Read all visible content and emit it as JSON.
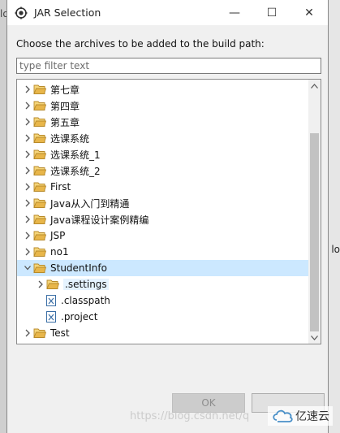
{
  "window": {
    "title": "JAR Selection",
    "minimize_glyph": "—",
    "maximize_glyph": "☐",
    "close_glyph": "✕"
  },
  "instruction": "Choose the archives to be added to the build path:",
  "filter": {
    "placeholder": "type filter text",
    "value": ""
  },
  "tree": {
    "items": [
      {
        "label": "第七章",
        "type": "folder",
        "expanded": false,
        "depth": 0
      },
      {
        "label": "第四章",
        "type": "folder",
        "expanded": false,
        "depth": 0
      },
      {
        "label": "第五章",
        "type": "folder",
        "expanded": false,
        "depth": 0
      },
      {
        "label": "选课系统",
        "type": "folder",
        "expanded": false,
        "depth": 0
      },
      {
        "label": "选课系统_1",
        "type": "folder",
        "expanded": false,
        "depth": 0
      },
      {
        "label": "选课系统_2",
        "type": "folder",
        "expanded": false,
        "depth": 0
      },
      {
        "label": "First",
        "type": "folder",
        "expanded": false,
        "depth": 0
      },
      {
        "label": "Java从入门到精通",
        "type": "folder",
        "expanded": false,
        "depth": 0
      },
      {
        "label": "Java课程设计案例精编",
        "type": "folder",
        "expanded": false,
        "depth": 0
      },
      {
        "label": "JSP",
        "type": "folder",
        "expanded": false,
        "depth": 0
      },
      {
        "label": "no1",
        "type": "folder",
        "expanded": false,
        "depth": 0
      },
      {
        "label": "StudentInfo",
        "type": "folder",
        "expanded": true,
        "depth": 0,
        "selected": true
      },
      {
        "label": ".settings",
        "type": "folder",
        "expanded": false,
        "depth": 1,
        "highlighted": true
      },
      {
        "label": ".classpath",
        "type": "xml-file",
        "expanded": null,
        "depth": 1
      },
      {
        "label": ".project",
        "type": "xml-file",
        "expanded": null,
        "depth": 1
      },
      {
        "label": "Test",
        "type": "folder",
        "expanded": false,
        "depth": 0
      }
    ]
  },
  "buttons": {
    "ok_label": "OK",
    "cancel_label": ""
  },
  "watermark": "https://blog.csdn.net/q",
  "brand": "亿速云",
  "background": {
    "left_text": "lo",
    "right_text": "lo"
  },
  "icons": {
    "app": "eclipse-gear-icon",
    "folder": "folder-icon",
    "xml_file": "xml-file-icon",
    "chevron_right": "chevron-right-icon",
    "chevron_down": "chevron-down-icon"
  },
  "colors": {
    "selection": "#cce8ff",
    "folder": "#e8b64a"
  }
}
